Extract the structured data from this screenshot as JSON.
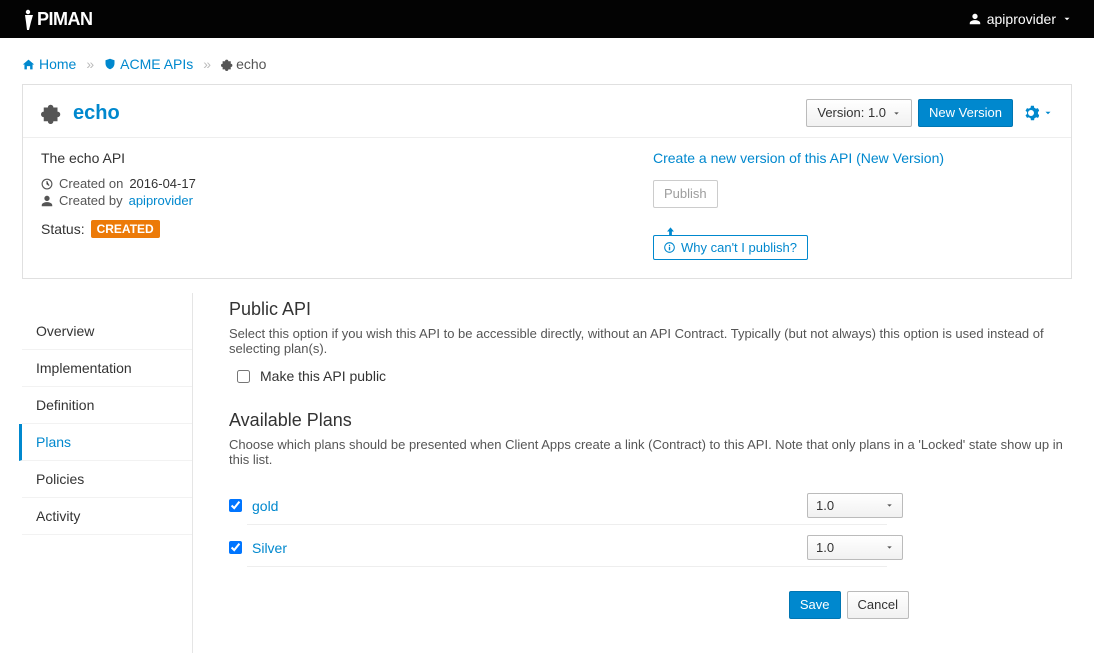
{
  "topbar": {
    "logo": "APIMAN",
    "user": "apiprovider"
  },
  "breadcrumb": {
    "home": "Home",
    "org": "ACME APIs",
    "api": "echo"
  },
  "header": {
    "api_name": "echo",
    "version_label": "Version: 1.0",
    "new_version_btn": "New Version"
  },
  "meta": {
    "description": "The echo API",
    "created_on_label": "Created on",
    "created_on_value": "2016-04-17",
    "created_by_label": "Created by",
    "created_by_value": "apiprovider",
    "status_label": "Status:",
    "status_value": "CREATED"
  },
  "actions": {
    "new_version_hint": "Create a new version of this API (New Version)",
    "publish": "Publish",
    "why_publish": "Why can't I publish?"
  },
  "tabs": [
    "Overview",
    "Implementation",
    "Definition",
    "Plans",
    "Policies",
    "Activity"
  ],
  "active_tab": "Plans",
  "public_api": {
    "title": "Public API",
    "desc": "Select this option if you wish this API to be accessible directly, without an API Contract. Typically (but not always) this option is used instead of selecting plan(s).",
    "checkbox_label": "Make this API public"
  },
  "plans_section": {
    "title": "Available Plans",
    "desc": "Choose which plans should be presented when Client Apps create a link (Contract) to this API. Note that only plans in a 'Locked' state show up in this list."
  },
  "plans": [
    {
      "name": "gold",
      "version": "1.0",
      "checked": true
    },
    {
      "name": "Silver",
      "version": "1.0",
      "checked": true
    }
  ],
  "footer": {
    "save": "Save",
    "cancel": "Cancel"
  }
}
